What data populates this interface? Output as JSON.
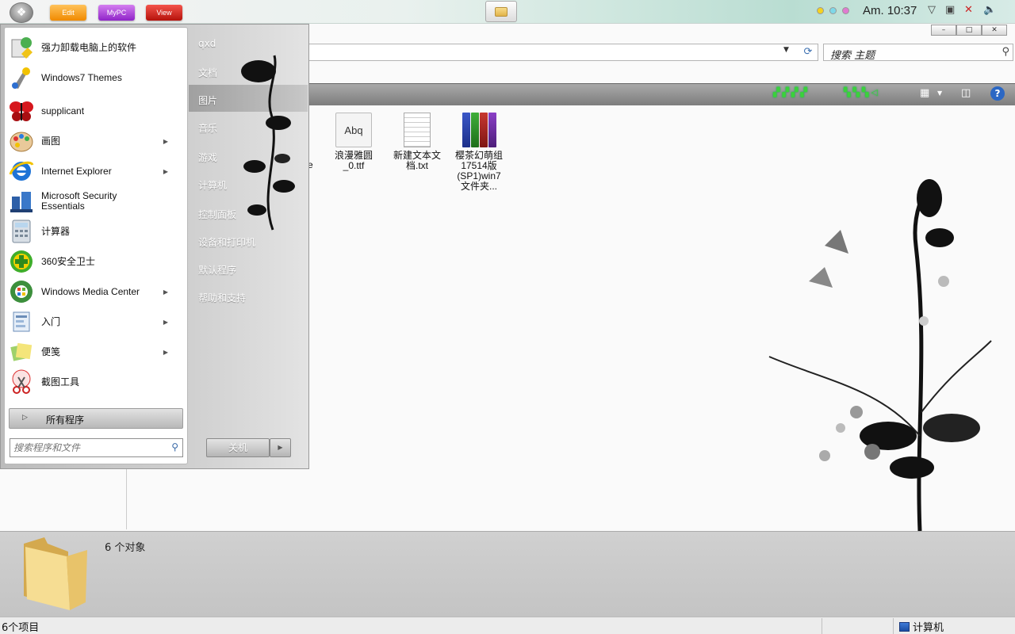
{
  "topbar": {
    "buttons": [
      "Edit",
      "MyPC",
      "View"
    ],
    "clock": "Am. 10:37"
  },
  "explorer": {
    "search_placeholder": "搜索 主题",
    "files": [
      {
        "name": "浪漫雅圆_0.ttf",
        "icon": "font-file-icon",
        "preview": "Abq"
      },
      {
        "name": "新建文本文档.txt",
        "icon": "text-file-icon"
      },
      {
        "name": "樱茶幻萌组17514版(SP1)win7文件夹...",
        "icon": "rar-archive-icon"
      }
    ],
    "partial_file_suffix": "e",
    "details": {
      "object_count": "6 个对象"
    },
    "status": {
      "items": "6个项目",
      "location": "计算机"
    }
  },
  "start_menu": {
    "programs": [
      {
        "label": "强力卸载电脑上的软件",
        "icon": "uninstall-icon",
        "has_submenu": false
      },
      {
        "label": "Windows7 Themes",
        "icon": "themes-icon",
        "has_submenu": false
      },
      {
        "label": "supplicant",
        "icon": "butterfly-icon",
        "has_submenu": false
      },
      {
        "label": "画图",
        "icon": "paint-icon",
        "has_submenu": true
      },
      {
        "label": "Internet Explorer",
        "icon": "ie-icon",
        "has_submenu": true
      },
      {
        "label": "Microsoft Security Essentials",
        "icon": "security-icon",
        "has_submenu": false
      },
      {
        "label": "计算器",
        "icon": "calculator-icon",
        "has_submenu": false
      },
      {
        "label": "360安全卫士",
        "icon": "360-icon",
        "has_submenu": false
      },
      {
        "label": "Windows Media Center",
        "icon": "media-center-icon",
        "has_submenu": true
      },
      {
        "label": "入门",
        "icon": "getting-started-icon",
        "has_submenu": true
      },
      {
        "label": "便笺",
        "icon": "sticky-notes-icon",
        "has_submenu": true
      },
      {
        "label": "截图工具",
        "icon": "snipping-tool-icon",
        "has_submenu": false
      }
    ],
    "all_programs": "所有程序",
    "search_placeholder": "搜索程序和文件",
    "right_links": [
      "qxd",
      "文档",
      "图片",
      "音乐",
      "游戏",
      "计算机",
      "控制面板",
      "设备和打印机",
      "默认程序",
      "帮助和支持"
    ],
    "highlighted_link": "图片",
    "shutdown": "关机"
  }
}
